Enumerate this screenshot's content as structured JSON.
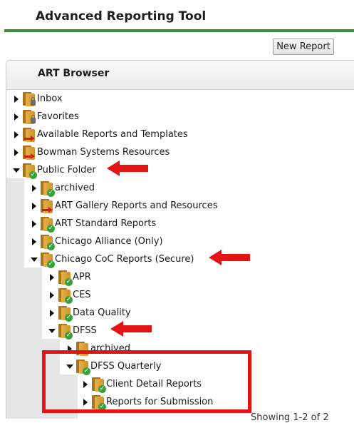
{
  "app": {
    "title": "Advanced Reporting Tool",
    "new_report_label": "New Report"
  },
  "browser": {
    "title": "ART Browser",
    "footer_partial": "Showing 1-2 of 2"
  },
  "tree": [
    {
      "label": "Inbox",
      "icon": "folder-lock-icon",
      "expanded": false
    },
    {
      "label": "Favorites",
      "icon": "folder-lock-icon",
      "expanded": false
    },
    {
      "label": "Available Reports and Templates",
      "icon": "folder-link-icon",
      "expanded": false
    },
    {
      "label": "Bowman Systems Resources",
      "icon": "folder-link-icon",
      "expanded": false
    },
    {
      "label": "Public Folder",
      "icon": "folder-check-icon",
      "expanded": true
    },
    {
      "label": "archived",
      "icon": "folder-check-icon",
      "expanded": false
    },
    {
      "label": "ART Gallery Reports and Resources",
      "icon": "folder-link-icon",
      "expanded": false
    },
    {
      "label": "ART Standard Reports",
      "icon": "folder-check-icon",
      "expanded": false
    },
    {
      "label": "Chicago Alliance (Only)",
      "icon": "folder-check-icon",
      "expanded": false
    },
    {
      "label": "Chicago CoC Reports (Secure)",
      "icon": "folder-check-icon",
      "expanded": true
    },
    {
      "label": "APR",
      "icon": "folder-check-icon",
      "expanded": false
    },
    {
      "label": "CES",
      "icon": "folder-check-icon",
      "expanded": false
    },
    {
      "label": "Data Quality",
      "icon": "folder-check-icon",
      "expanded": false
    },
    {
      "label": "DFSS",
      "icon": "folder-check-icon",
      "expanded": true
    },
    {
      "label": "archived",
      "icon": "folder-icon",
      "expanded": false
    },
    {
      "label": "DFSS Quarterly",
      "icon": "folder-check-icon",
      "expanded": true
    },
    {
      "label": "Client Detail Reports",
      "icon": "folder-check-icon",
      "expanded": false
    },
    {
      "label": "Reports for Submission",
      "icon": "folder-check-icon",
      "expanded": false
    }
  ],
  "colors": {
    "accent_green": "#3a8a3a",
    "annotation_red": "#e31414"
  }
}
